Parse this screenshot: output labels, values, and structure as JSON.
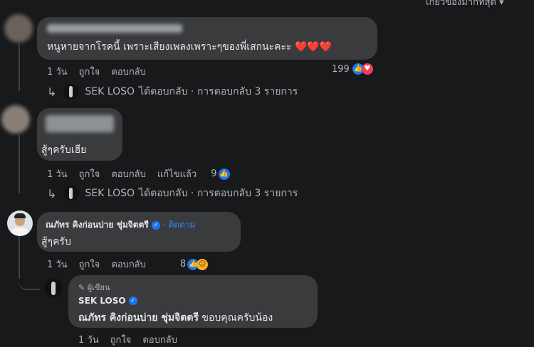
{
  "top": {
    "sort_label": "เกี่ยวข้องมากที่สุด ▾"
  },
  "comment1": {
    "text": "หนูหายจากโรคนี้ เพราะเสียงเพลงเพราะๆของพี่เสกนะคะะ ❤️❤️❤️",
    "time": "1 วัน",
    "like": "ถูกใจ",
    "reply": "ตอบกลับ",
    "reaction_count": "199",
    "replies": {
      "author": "SEK LOSO",
      "text": "ได้ตอบกลับ · การตอบกลับ 3 รายการ"
    }
  },
  "comment2": {
    "text": "สู้ๆครับเฮีย",
    "time": "1 วัน",
    "like": "ถูกใจ",
    "reply": "ตอบกลับ",
    "edited": "แก้ไขแล้ว",
    "reaction_count": "9",
    "replies": {
      "author": "SEK LOSO",
      "text": "ได้ตอบกลับ · การตอบกลับ 3 รายการ"
    }
  },
  "comment3": {
    "author": "ณภัทร คิงก่อนบ่าย ชุ่มจิตตรี",
    "follow": "· ติดตาม",
    "text": "สู้ๆครับ",
    "time": "1 วัน",
    "like": "ถูกใจ",
    "reply": "ตอบกลับ",
    "reaction_count": "8"
  },
  "reply3": {
    "badge": "✎ ผู้เขียน",
    "author": "SEK LOSO",
    "mention": "ณภัทร คิงก่อนบ่าย ชุ่มจิตตรี",
    "text": " ขอบคุณครับน้อง",
    "time": "1 วัน",
    "like": "ถูกใจ",
    "reply": "ตอบกลับ"
  },
  "colors": {
    "background": "#18191a",
    "bubble": "#3a3b3c",
    "accent": "#1877f2",
    "muted": "#b0b3b8"
  }
}
